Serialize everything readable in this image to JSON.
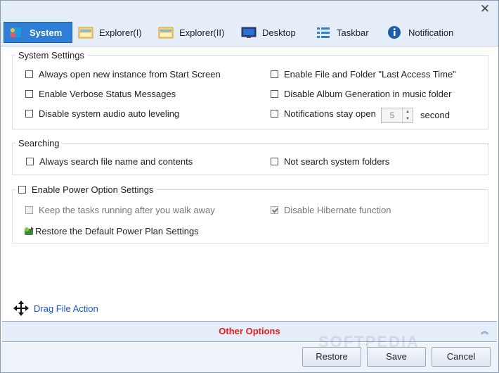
{
  "window": {
    "close_glyph": "✕"
  },
  "tabs": [
    {
      "label": "System",
      "icon": "system-settings-icon",
      "active": true
    },
    {
      "label": "Explorer(I)",
      "icon": "folder-window-icon"
    },
    {
      "label": "Explorer(II)",
      "icon": "folder-window-icon"
    },
    {
      "label": "Desktop",
      "icon": "monitor-icon"
    },
    {
      "label": "Taskbar",
      "icon": "list-icon"
    },
    {
      "label": "Notification",
      "icon": "info-icon"
    }
  ],
  "system_settings": {
    "title": "System Settings",
    "options": [
      {
        "label": "Always open new instance from Start Screen",
        "checked": false
      },
      {
        "label": "Enable File and Folder \"Last Access Time\"",
        "checked": false
      },
      {
        "label": "Enable Verbose Status Messages",
        "checked": false
      },
      {
        "label": "Disable Album Generation in music folder",
        "checked": false
      },
      {
        "label": "Disable system audio auto leveling",
        "checked": false
      },
      {
        "label": "Notifications stay open",
        "checked": false
      }
    ],
    "notification_seconds": "5",
    "seconds_unit": "second"
  },
  "searching": {
    "title": "Searching",
    "options": [
      {
        "label": "Always search file name and contents",
        "checked": false
      },
      {
        "label": "Not search system folders",
        "checked": false
      }
    ]
  },
  "power": {
    "title": "Enable Power Option Settings",
    "options": [
      {
        "label": "Keep the tasks running after you walk away",
        "checked": false,
        "disabled": true
      },
      {
        "label": "Disable Hibernate function",
        "checked": true,
        "disabled": true
      }
    ],
    "restore_label": "Restore the Default Power Plan Settings"
  },
  "drag_file_action": "Drag File Action",
  "other_options": {
    "label": "Other Options",
    "collapse_glyph": "︽"
  },
  "buttons": {
    "restore": "Restore",
    "save": "Save",
    "cancel": "Cancel"
  },
  "watermark": "SOFTPEDIA",
  "colors": {
    "accent": "#2f7ed8",
    "other_options_text": "#e0201a",
    "link": "#1a56c4"
  }
}
